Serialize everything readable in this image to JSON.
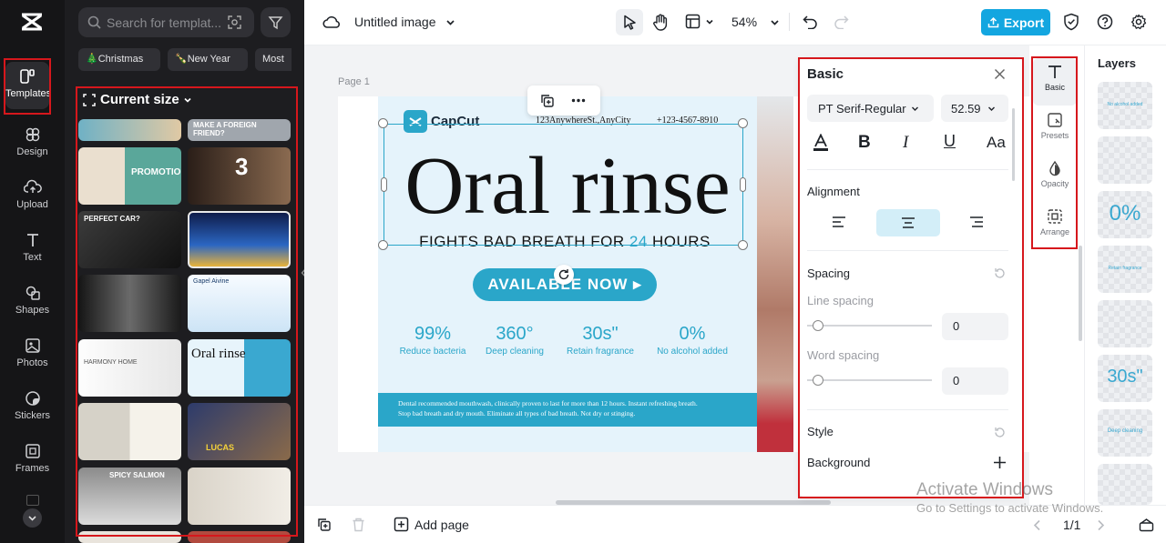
{
  "rail": {
    "logo_icon": "capcut-logo-icon",
    "items": [
      {
        "label": "Templates",
        "icon": "templates-icon"
      },
      {
        "label": "Design",
        "icon": "design-icon"
      },
      {
        "label": "Upload",
        "icon": "upload-icon"
      },
      {
        "label": "Text",
        "icon": "text-icon"
      },
      {
        "label": "Shapes",
        "icon": "shapes-icon"
      },
      {
        "label": "Photos",
        "icon": "photos-icon"
      },
      {
        "label": "Stickers",
        "icon": "stickers-icon"
      },
      {
        "label": "Frames",
        "icon": "frames-icon"
      }
    ]
  },
  "templates_panel": {
    "search_placeholder": "Search for templat...",
    "chips": [
      "🎄Christmas",
      "🍾New Year",
      "Most"
    ],
    "section_title": "Current size",
    "thumbs": [
      {
        "text": ""
      },
      {
        "text": "MAKE A FOREIGN FRIEND?"
      },
      {
        "text": "PROMOTION"
      },
      {
        "text": "3"
      },
      {
        "text": "PERFECT CAR?"
      },
      {
        "text": ""
      },
      {
        "text": ""
      },
      {
        "text": "Gapel Aivine"
      },
      {
        "text": "HARMONY HOME"
      },
      {
        "text": "Oral rinse"
      },
      {
        "text": ""
      },
      {
        "text": "LUCAS"
      },
      {
        "text": "SPICY SALMON"
      },
      {
        "text": ""
      }
    ]
  },
  "topbar": {
    "doc_title": "Untitled image",
    "zoom": "54%",
    "export_label": "Export"
  },
  "canvas": {
    "page_label": "Page 1",
    "brand": "CapCut",
    "address": "123AnywhereSt.,AnyCity",
    "phone": "+123-4567-8910",
    "headline": "Oral rinse",
    "subhead_before": "FIGHTS BAD BREATH FOR ",
    "subhead_num": "24",
    "subhead_after": " HOURS",
    "cta": "AVAILABLE NOW ▸",
    "stats": [
      {
        "value": "99%",
        "label": "Reduce bacteria"
      },
      {
        "value": "360°",
        "label": "Deep cleaning"
      },
      {
        "value": "30s\"",
        "label": "Retain fragrance"
      },
      {
        "value": "0%",
        "label": "No alcohol added"
      }
    ],
    "footer_line1": "Dental recommended mouthwash, clinically proven to last for more than 12 hours. Instant refreshing breath.",
    "footer_line2": "Stop bad breath and dry mouth. Eliminate all types of bad breath. Not dry or stinging.",
    "accent": "#2aa6c9",
    "banner_color": "#2aa6c9"
  },
  "props": {
    "title": "Basic",
    "font_name": "PT Serif-Regular",
    "font_size": "52.59",
    "alignment_label": "Alignment",
    "spacing_label": "Spacing",
    "line_spacing_label": "Line spacing",
    "line_spacing_value": "0",
    "word_spacing_label": "Word spacing",
    "word_spacing_value": "0",
    "style_label": "Style",
    "background_label": "Background"
  },
  "side_tabs": [
    {
      "label": "Basic",
      "icon": "text-basic-icon"
    },
    {
      "label": "Presets",
      "icon": "presets-icon"
    },
    {
      "label": "Opacity",
      "icon": "opacity-icon"
    },
    {
      "label": "Arrange",
      "icon": "arrange-icon"
    }
  ],
  "layers": {
    "title": "Layers",
    "items": [
      {
        "text": "No alcohol added"
      },
      {
        "text": ""
      },
      {
        "text": "0%"
      },
      {
        "text": "Retain fragrance"
      },
      {
        "text": ""
      },
      {
        "text": "30s\""
      },
      {
        "text": "Deep cleaning"
      },
      {
        "text": ""
      }
    ]
  },
  "bottombar": {
    "add_page_label": "Add page",
    "page_count": "1/1"
  },
  "watermark": {
    "line1": "Activate Windows",
    "line2": "Go to Settings to activate Windows."
  }
}
